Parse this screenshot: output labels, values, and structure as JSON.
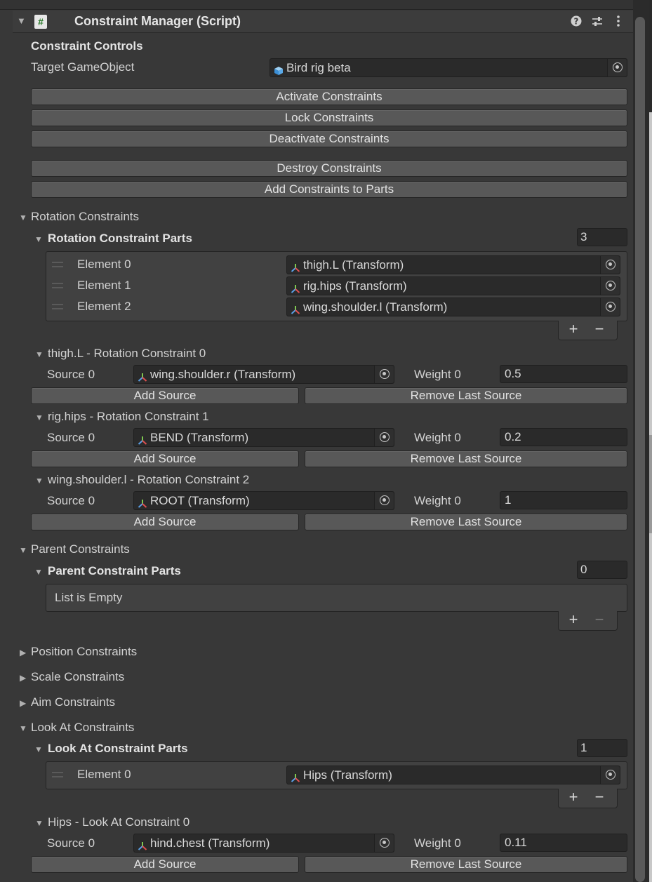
{
  "header": {
    "title": "Constraint Manager (Script)",
    "script_icon": "#"
  },
  "controls": {
    "title": "Constraint Controls",
    "target_label": "Target GameObject",
    "target_value": "Bird rig beta",
    "buttons": [
      "Activate Constraints",
      "Lock Constraints",
      "Deactivate Constraints",
      "Destroy Constraints",
      "Add Constraints to Parts"
    ]
  },
  "rotation": {
    "title": "Rotation Constraints",
    "parts_title": "Rotation Constraint Parts",
    "count": "3",
    "elements": [
      {
        "label": "Element 0",
        "value": "thigh.L (Transform)"
      },
      {
        "label": "Element 1",
        "value": "rig.hips (Transform)"
      },
      {
        "label": "Element 2",
        "value": "wing.shoulder.l (Transform)"
      }
    ],
    "constraints": [
      {
        "title": "thigh.L - Rotation Constraint 0",
        "source_label": "Source 0",
        "source": "wing.shoulder.r (Transform)",
        "weight_label": "Weight 0",
        "weight": "0.5"
      },
      {
        "title": "rig.hips - Rotation Constraint 1",
        "source_label": "Source 0",
        "source": "BEND (Transform)",
        "weight_label": "Weight 0",
        "weight": "0.2"
      },
      {
        "title": "wing.shoulder.l - Rotation Constraint 2",
        "source_label": "Source 0",
        "source": "ROOT (Transform)",
        "weight_label": "Weight 0",
        "weight": "1"
      }
    ]
  },
  "parent": {
    "title": "Parent Constraints",
    "parts_title": "Parent Constraint Parts",
    "count": "0",
    "empty_text": "List is Empty"
  },
  "collapsed": [
    "Position Constraints",
    "Scale Constraints",
    "Aim Constraints"
  ],
  "lookat": {
    "title": "Look At Constraints",
    "parts_title": "Look At Constraint Parts",
    "count": "1",
    "elements": [
      {
        "label": "Element 0",
        "value": "Hips (Transform)"
      }
    ],
    "constraints": [
      {
        "title": "Hips - Look At Constraint 0",
        "source_label": "Source 0",
        "source": "hind.chest (Transform)",
        "weight_label": "Weight 0",
        "weight": "0.11"
      }
    ]
  },
  "labels": {
    "add_source": "Add Source",
    "remove_last_source": "Remove Last Source",
    "plus": "+",
    "minus": "−"
  },
  "colors": {
    "background": "#383838",
    "button": "#585858",
    "field": "#2a2a2a",
    "transform_icon_green": "#7ec850",
    "transform_icon_blue": "#5aa0e6",
    "transform_icon_red": "#e05050"
  },
  "icons": {
    "help": "help-icon",
    "presets": "presets-icon",
    "menu": "kebab-menu-icon",
    "gameobject": "cube-icon",
    "transform": "transform-icon"
  }
}
